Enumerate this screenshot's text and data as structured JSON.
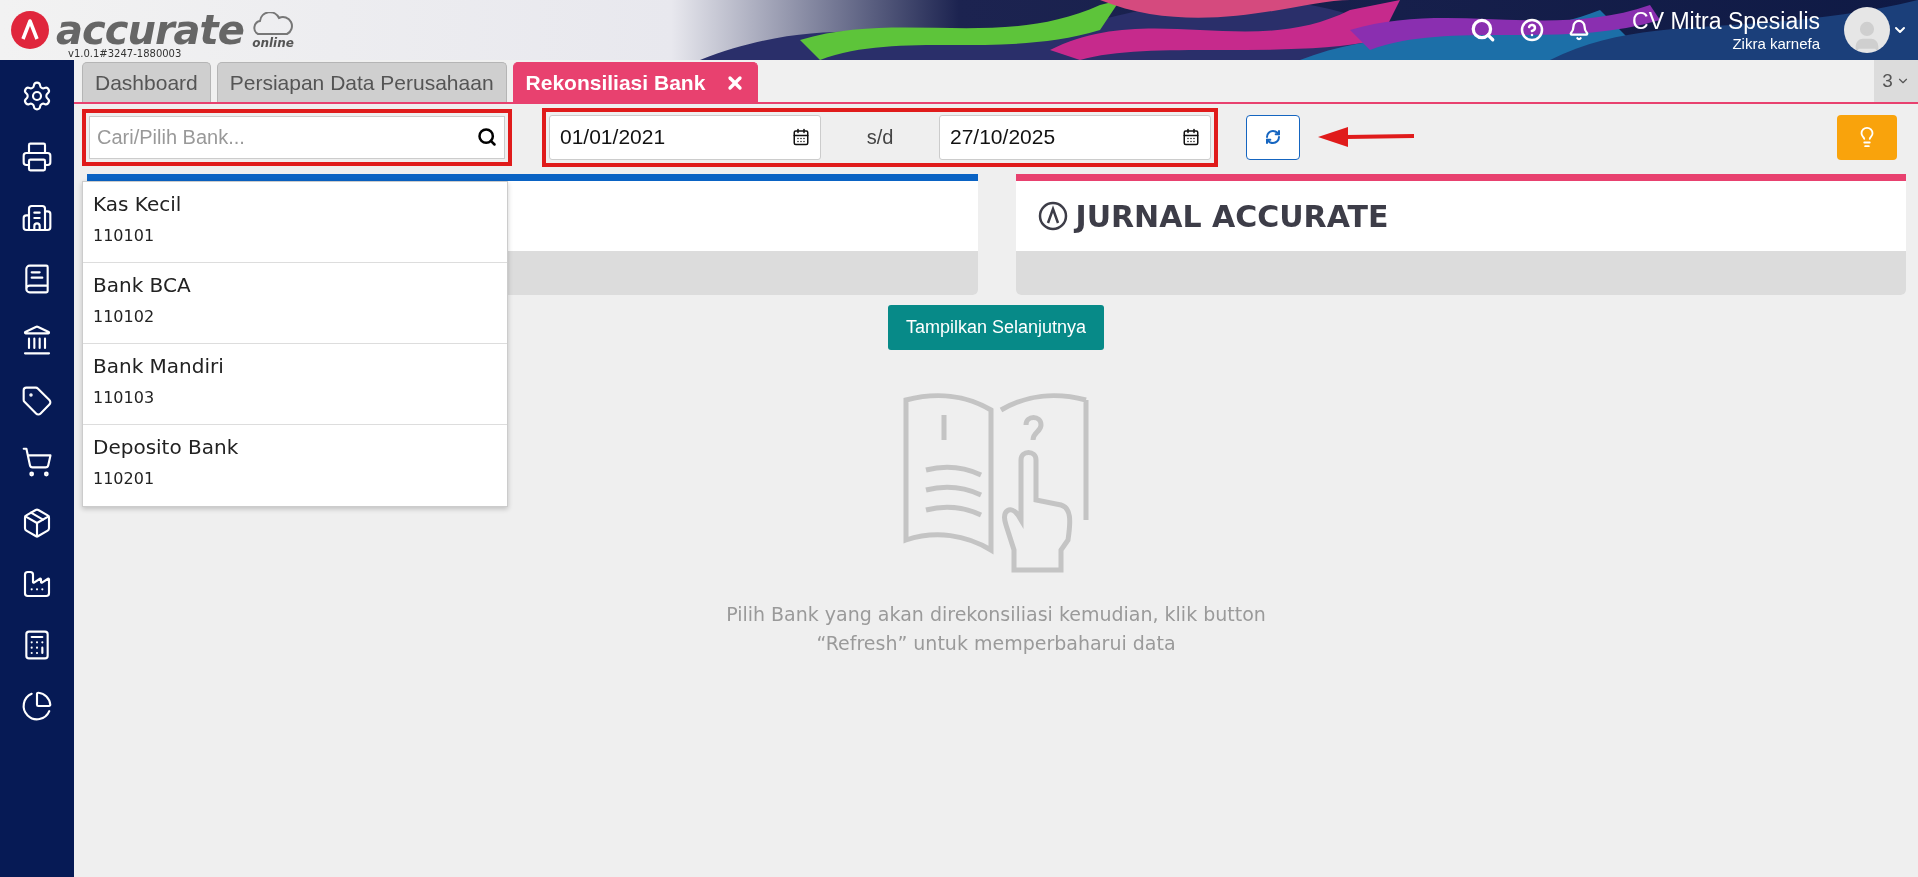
{
  "app": {
    "logo": "accurate",
    "logo_sub": "online",
    "version": "v1.0.1#3247-1880003"
  },
  "user": {
    "company": "CV Mitra Spesialis",
    "name": "Zikra karnefa"
  },
  "tabs": [
    {
      "label": "Dashboard",
      "selected": false,
      "closable": false
    },
    {
      "label": "Persiapan Data Perusahaan",
      "selected": false,
      "closable": false
    },
    {
      "label": "Rekonsiliasi Bank",
      "selected": true,
      "closable": true
    }
  ],
  "tab_count": "3",
  "bank_search": {
    "placeholder": "Cari/Pilih Bank...",
    "options": [
      {
        "name": "Kas Kecil",
        "code": "110101"
      },
      {
        "name": "Bank BCA",
        "code": "110102"
      },
      {
        "name": "Bank Mandiri",
        "code": "110103"
      },
      {
        "name": "Deposito Bank",
        "code": "110201"
      }
    ]
  },
  "date_range": {
    "from": "01/01/2021",
    "separator": "s/d",
    "to": "27/10/2025"
  },
  "cards": [
    {
      "color": "#0a63c4"
    },
    {
      "title": "JURNAL ACCURATE",
      "color": "#e8416f"
    }
  ],
  "more_button": "Tampilkan Selanjutnya",
  "empty_state": {
    "message": "Pilih Bank yang akan direkonsiliasi kemudian, klik button “Refresh” untuk memperbaharui data"
  }
}
